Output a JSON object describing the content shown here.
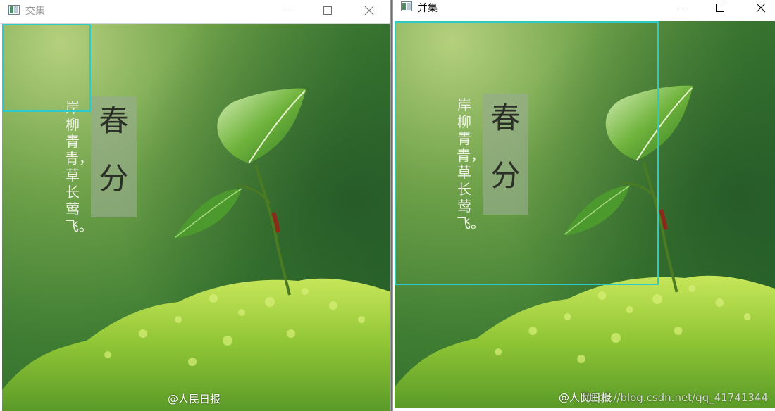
{
  "left_window": {
    "title": "交集",
    "controls": {
      "minimize": "minimize-icon",
      "maximize": "maximize-icon",
      "close": "close-icon"
    }
  },
  "right_window": {
    "title": "并集",
    "controls": {
      "minimize": "minimize-icon",
      "maximize": "maximize-icon",
      "close": "close-icon"
    }
  },
  "image": {
    "title_chars": [
      "春",
      "分"
    ],
    "poem": "岸柳青青，草长莺飞。",
    "watermark": "@人民日报"
  },
  "page_watermark": "https://blog.csdn.net/qq_41741344",
  "colors": {
    "selection_rect": "#2ec9c9",
    "background_green": "#4e8d3a",
    "moss": "#a6d83a"
  }
}
